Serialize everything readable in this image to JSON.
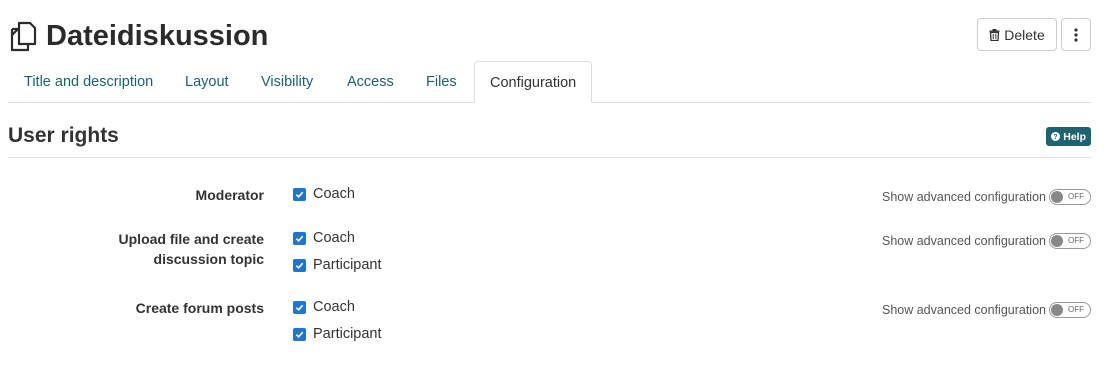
{
  "header": {
    "title": "Dateidiskussion",
    "title_icon": "file-copy-icon",
    "delete_label": "Delete",
    "delete_icon": "trash-icon",
    "more_icon": "vertical-ellipsis-icon"
  },
  "tabs": [
    {
      "label": "Title and description",
      "active": false
    },
    {
      "label": "Layout",
      "active": false
    },
    {
      "label": "Visibility",
      "active": false
    },
    {
      "label": "Access",
      "active": false
    },
    {
      "label": "Files",
      "active": false
    },
    {
      "label": "Configuration",
      "active": true
    }
  ],
  "section": {
    "title": "User rights",
    "help_label": "Help",
    "help_icon": "question-circle-icon"
  },
  "rights": [
    {
      "label": "Moderator",
      "options": [
        {
          "label": "Coach",
          "checked": true
        }
      ],
      "advanced_label": "Show advanced configuration",
      "advanced_toggle": "OFF"
    },
    {
      "label": "Upload file and create discussion topic",
      "options": [
        {
          "label": "Coach",
          "checked": true
        },
        {
          "label": "Participant",
          "checked": true
        }
      ],
      "advanced_label": "Show advanced configuration",
      "advanced_toggle": "OFF"
    },
    {
      "label": "Create forum posts",
      "options": [
        {
          "label": "Coach",
          "checked": true
        },
        {
          "label": "Participant",
          "checked": true
        }
      ],
      "advanced_label": "Show advanced configuration",
      "advanced_toggle": "OFF"
    }
  ],
  "colors": {
    "accent": "#1e6370",
    "tab_link": "#1a6170",
    "checkbox": "#1f76d2"
  }
}
